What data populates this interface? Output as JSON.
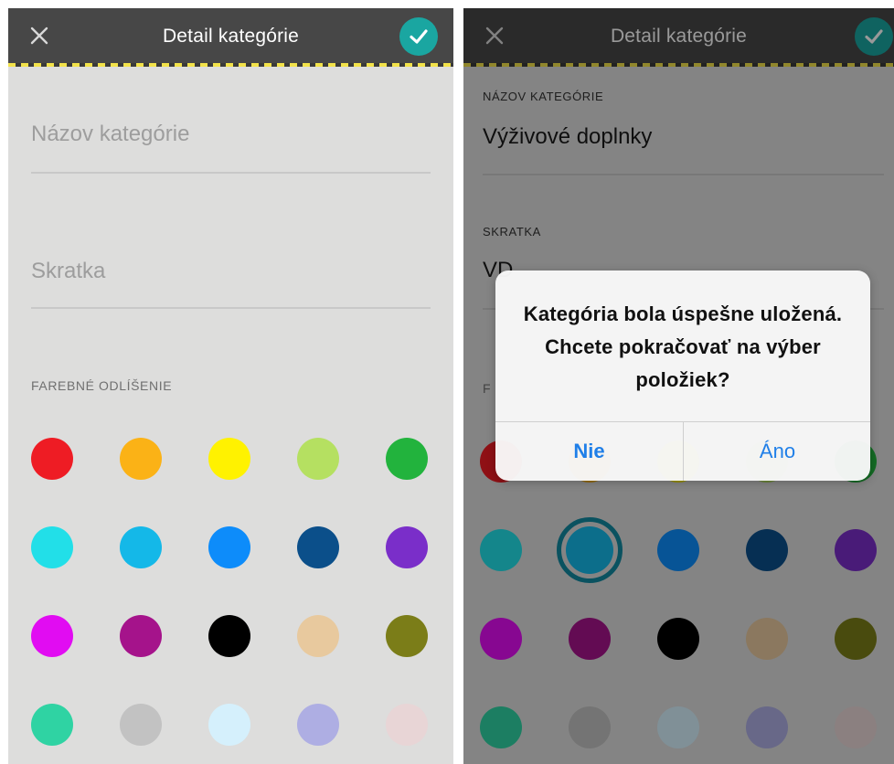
{
  "left_screen": {
    "nav": {
      "title": "Detail kategórie",
      "close_icon": "close-icon",
      "confirm_icon": "checkmark-icon"
    },
    "name_field": {
      "placeholder": "Názov kategórie"
    },
    "shortcut_field": {
      "placeholder": "Skratka"
    },
    "color_section_label": "FAREBNÉ ODLÍŠENIE",
    "colors": [
      "#ee1c24",
      "#fbb216",
      "#fff200",
      "#b5e061",
      "#22b33d",
      "#22dfe8",
      "#14b8e8",
      "#0d8cfa",
      "#0b4f8a",
      "#7a2ec9",
      "#e10cf2",
      "#a5138b",
      "#000000",
      "#e8c99e",
      "#7b7d18",
      "#2fd3a3",
      "#c2c2c2",
      "#d5f0fc",
      "#aeaee3",
      "#e8d5d6"
    ]
  },
  "right_screen": {
    "nav": {
      "title": "Detail kategórie",
      "close_icon": "close-icon",
      "confirm_icon": "checkmark-icon"
    },
    "name_label": "NÁZOV KATEGÓRIE",
    "name_value": "Výživové doplnky",
    "shortcut_label": "SKRATKA",
    "shortcut_value": "VD",
    "color_section_label_partial": "F",
    "selected_color": "#14b8e8",
    "colors": [
      "#ee1c24",
      "#fbb216",
      "#fff200",
      "#b5e061",
      "#22b33d",
      "#22dfe8",
      "#14b8e8",
      "#0d8cfa",
      "#0b4f8a",
      "#7a2ec9",
      "#e10cf2",
      "#a5138b",
      "#000000",
      "#e8c99e",
      "#7b7d18",
      "#2fd3a3",
      "#c2c2c2",
      "#d5f0fc",
      "#aeaee3",
      "#e8d5d6"
    ],
    "alert": {
      "message": "Kategória bola úspešne uložená. Chcete pokračovať na výber položiek?",
      "no_label": "Nie",
      "yes_label": "Áno"
    }
  }
}
